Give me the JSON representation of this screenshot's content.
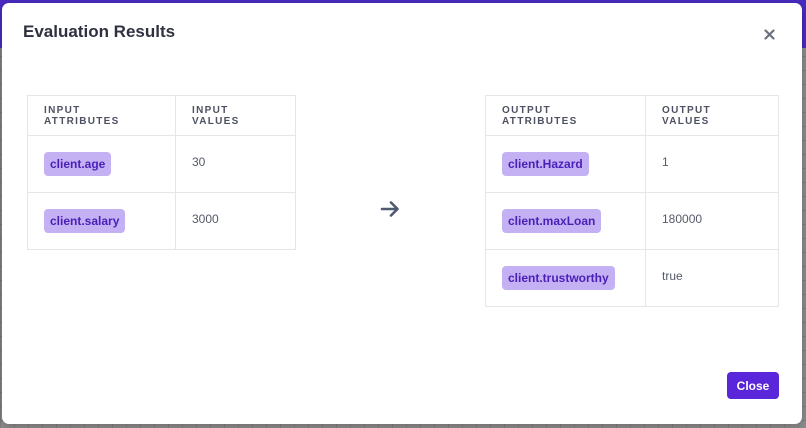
{
  "dialog": {
    "title": "Evaluation Results",
    "close_label": "Close"
  },
  "input_table": {
    "headers": [
      "Input Attributes",
      "Input Values"
    ],
    "rows": [
      {
        "attribute": "client.age",
        "value": "30"
      },
      {
        "attribute": "client.salary",
        "value": "3000"
      }
    ]
  },
  "output_table": {
    "headers": [
      "Output Attributes",
      "Output Values"
    ],
    "rows": [
      {
        "attribute": "client.Hazard",
        "value": "1"
      },
      {
        "attribute": "client.maxLoan",
        "value": "180000"
      },
      {
        "attribute": "client.trustworthy",
        "value": "true"
      }
    ]
  },
  "icons": {
    "close": "close-icon",
    "arrow": "arrow-right-icon"
  },
  "colors": {
    "accent": "#5a26d9",
    "chip_bg": "#c4b1f4",
    "chip_text": "#4a1fb8",
    "backdrop_accent": "#4a2bc4"
  }
}
